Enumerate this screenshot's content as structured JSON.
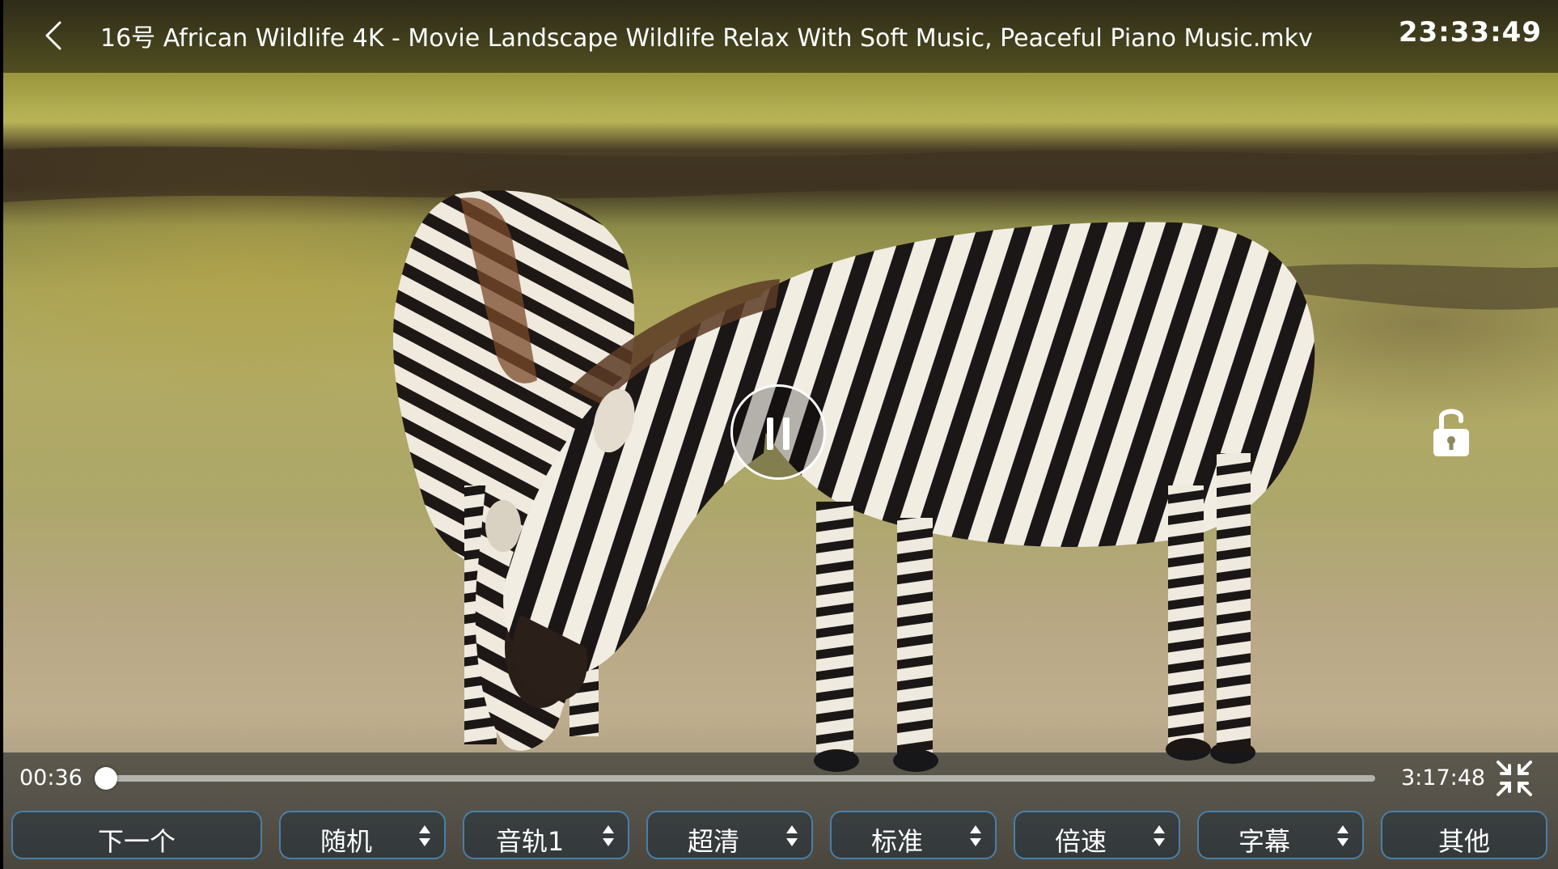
{
  "header": {
    "title": "16号 African Wildlife 4K - Movie Landscape Wildlife Relax With Soft Music, Peaceful Piano Music.mkv",
    "clock": "23:33:49",
    "back_icon": "chevron-left-icon"
  },
  "player": {
    "state_icon": "pause-icon",
    "lock_icon": "unlock-icon",
    "fullscreen_icon": "exit-fullscreen-icon"
  },
  "progress": {
    "current": "00:36",
    "total": "3:17:48",
    "fraction": 0.003
  },
  "controls": [
    {
      "label": "下一个",
      "has_arrows": false
    },
    {
      "label": "随机",
      "has_arrows": true
    },
    {
      "label": "音轨1",
      "has_arrows": true
    },
    {
      "label": "超清",
      "has_arrows": true
    },
    {
      "label": "标准",
      "has_arrows": true
    },
    {
      "label": "倍速",
      "has_arrows": true
    },
    {
      "label": "字幕",
      "has_arrows": true
    },
    {
      "label": "其他",
      "has_arrows": false
    }
  ],
  "colors": {
    "button_border": "#4a7fa6",
    "overlay": "#000000"
  }
}
